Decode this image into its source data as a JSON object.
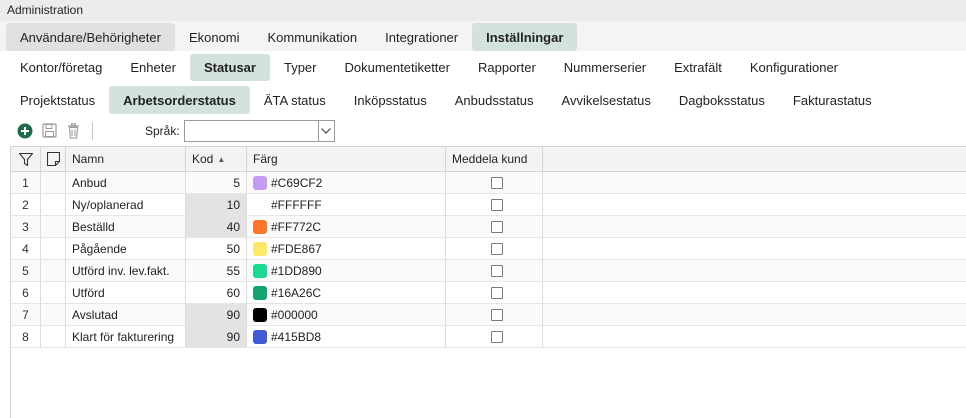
{
  "window": {
    "title": "Administration"
  },
  "tabs_level1": [
    {
      "label": "Användare/Behörigheter",
      "state": "selected-gray"
    },
    {
      "label": "Ekonomi",
      "state": ""
    },
    {
      "label": "Kommunikation",
      "state": ""
    },
    {
      "label": "Integrationer",
      "state": ""
    },
    {
      "label": "Inställningar",
      "state": "active"
    }
  ],
  "tabs_level2": [
    {
      "label": "Kontor/företag",
      "state": ""
    },
    {
      "label": "Enheter",
      "state": ""
    },
    {
      "label": "Statusar",
      "state": "active"
    },
    {
      "label": "Typer",
      "state": ""
    },
    {
      "label": "Dokumentetiketter",
      "state": ""
    },
    {
      "label": "Rapporter",
      "state": ""
    },
    {
      "label": "Nummerserier",
      "state": ""
    },
    {
      "label": "Extrafält",
      "state": ""
    },
    {
      "label": "Konfigurationer",
      "state": ""
    }
  ],
  "tabs_level3": [
    {
      "label": "Projektstatus",
      "state": ""
    },
    {
      "label": "Arbetsorderstatus",
      "state": "active"
    },
    {
      "label": "ÄTA status",
      "state": ""
    },
    {
      "label": "Inköpsstatus",
      "state": ""
    },
    {
      "label": "Anbudsstatus",
      "state": ""
    },
    {
      "label": "Avvikelsestatus",
      "state": ""
    },
    {
      "label": "Dagboksstatus",
      "state": ""
    },
    {
      "label": "Fakturastatus",
      "state": ""
    }
  ],
  "toolbar": {
    "language_label": "Språk:",
    "language_value": "",
    "icons": {
      "add": "add-circle-icon",
      "save": "save-icon",
      "delete": "trash-icon"
    },
    "accent": "#1f6b4a"
  },
  "grid": {
    "columns": {
      "name": "Namn",
      "kod": "Kod",
      "farg": "Färg",
      "meddela": "Meddela kund"
    },
    "sort": {
      "column": "kod",
      "direction": "asc"
    },
    "rows": [
      {
        "num": "1",
        "name": "Anbud",
        "kod": "5",
        "kod_shaded": false,
        "color_hex": "#C69CF2",
        "swatch": "#C69CF2",
        "checked": false
      },
      {
        "num": "2",
        "name": "Ny/oplanerad",
        "kod": "10",
        "kod_shaded": true,
        "color_hex": "#FFFFFF",
        "swatch": "#FFFFFF",
        "checked": false
      },
      {
        "num": "3",
        "name": "Beställd",
        "kod": "40",
        "kod_shaded": true,
        "color_hex": "#FF772C",
        "swatch": "#FF772C",
        "checked": false
      },
      {
        "num": "4",
        "name": "Pågående",
        "kod": "50",
        "kod_shaded": false,
        "color_hex": "#FDE867",
        "swatch": "#FDE867",
        "checked": false
      },
      {
        "num": "5",
        "name": "Utförd inv. lev.fakt.",
        "kod": "55",
        "kod_shaded": false,
        "color_hex": "#1DD890",
        "swatch": "#1DD890",
        "checked": false
      },
      {
        "num": "6",
        "name": "Utförd",
        "kod": "60",
        "kod_shaded": false,
        "color_hex": "#16A26C",
        "swatch": "#16A26C",
        "checked": false
      },
      {
        "num": "7",
        "name": "Avslutad",
        "kod": "90",
        "kod_shaded": true,
        "color_hex": "#000000",
        "swatch": "#000000",
        "checked": false
      },
      {
        "num": "8",
        "name": "Klart för fakturering",
        "kod": "90",
        "kod_shaded": true,
        "color_hex": "#415BD8",
        "swatch": "#415BD8",
        "checked": false
      }
    ]
  }
}
